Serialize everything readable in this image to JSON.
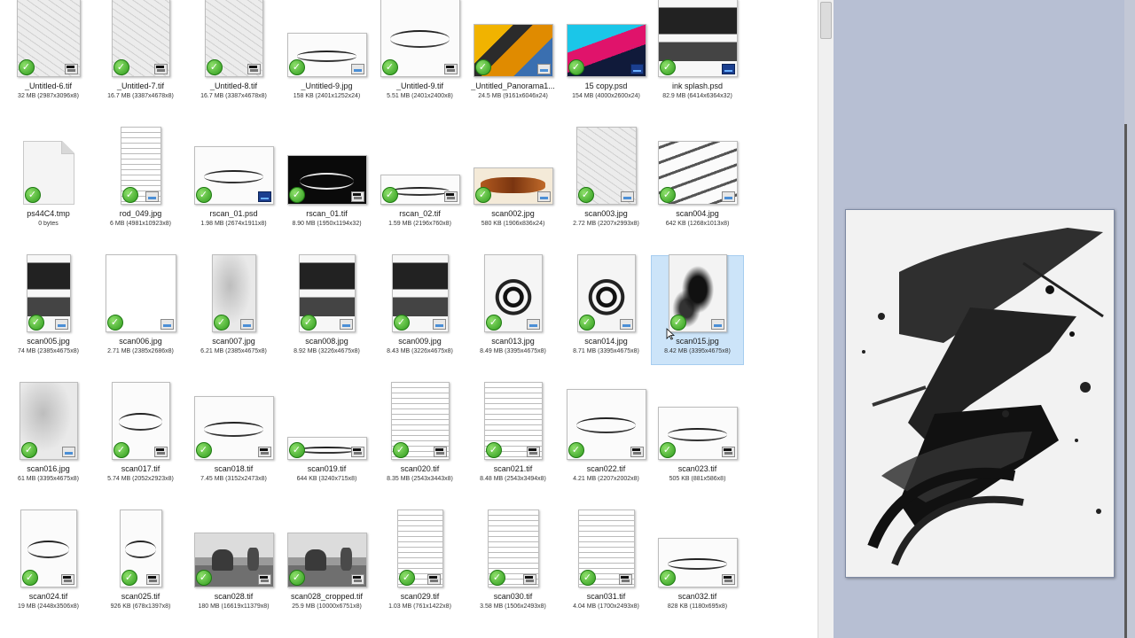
{
  "files": [
    {
      "name": "_Untitled-6.tif",
      "meta": "32 MB (2987x3096x8)",
      "style": "sketch",
      "badge": "tif"
    },
    {
      "name": "_Untitled-7.tif",
      "meta": "16.7 MB (3387x4678x8)",
      "style": "sketch",
      "badge": "tif"
    },
    {
      "name": "_Untitled-8.tif",
      "meta": "16.7 MB (3387x4678x8)",
      "style": "sketch",
      "badge": "tif"
    },
    {
      "name": "_Untitled-9.jpg",
      "meta": "158 KB (2401x1252x24)",
      "style": "script",
      "badge": "jpg"
    },
    {
      "name": "_Untitled-9.tif",
      "meta": "5.51 MB (2401x2400x8)",
      "style": "script",
      "badge": "tif"
    },
    {
      "name": "_Untitled_Panorama1...",
      "meta": "24.5 MB (9161x6046x24)",
      "style": "orange",
      "badge": "jpg"
    },
    {
      "name": "15 copy.psd",
      "meta": "154 MB (4000x2600x24)",
      "style": "neon",
      "badge": "psd"
    },
    {
      "name": "ink splash.psd",
      "meta": "82.9 MB (6414x6364x32)",
      "style": "ink-b",
      "badge": "psd"
    },
    {
      "name": "ps44C4.tmp",
      "meta": "0 bytes",
      "style": "tmp",
      "badge": ""
    },
    {
      "name": "rod_049.jpg",
      "meta": "6 MB (4981x10923x8)",
      "style": "text-doc",
      "badge": "jpg"
    },
    {
      "name": "rscan_01.psd",
      "meta": "1.98 MB (2674x1911x8)",
      "style": "script",
      "badge": "psd"
    },
    {
      "name": "rscan_01.tif",
      "meta": "8.90 MB (1950x1194x32)",
      "style": "black",
      "badge": "tif"
    },
    {
      "name": "rscan_02.tif",
      "meta": "1.59 MB (2196x760x8)",
      "style": "script",
      "badge": "tif"
    },
    {
      "name": "scan002.jpg",
      "meta": "580 KB (1906x836x24)",
      "style": "brown",
      "badge": "jpg"
    },
    {
      "name": "scan003.jpg",
      "meta": "2.72 MB (2207x2993x8)",
      "style": "sketch",
      "badge": "jpg"
    },
    {
      "name": "scan004.jpg",
      "meta": "642 KB (1268x1013x8)",
      "style": "strokes",
      "badge": "jpg"
    },
    {
      "name": "scan005.jpg",
      "meta": "74 MB (2385x4675x8)",
      "style": "ink-b",
      "badge": "jpg"
    },
    {
      "name": "scan006.jpg",
      "meta": "2.71 MB (2385x2686x8)",
      "style": "blank",
      "badge": "jpg"
    },
    {
      "name": "scan007.jpg",
      "meta": "6.21 MB (2385x4675x8)",
      "style": "gray-wash",
      "badge": "jpg"
    },
    {
      "name": "scan008.jpg",
      "meta": "8.92 MB (3226x4675x8)",
      "style": "ink-b",
      "badge": "jpg"
    },
    {
      "name": "scan009.jpg",
      "meta": "8.43 MB (3226x4675x8)",
      "style": "ink-b",
      "badge": "jpg"
    },
    {
      "name": "scan013.jpg",
      "meta": "8.49 MB (3395x4675x8)",
      "style": "ink-c",
      "badge": "jpg"
    },
    {
      "name": "scan014.jpg",
      "meta": "8.71 MB (3395x4675x8)",
      "style": "ink-c",
      "badge": "jpg"
    },
    {
      "name": "scan015.jpg",
      "meta": "8.42 MB (3395x4675x8)",
      "style": "ink-a",
      "badge": "jpg",
      "selected": true
    },
    {
      "name": "scan016.jpg",
      "meta": "61 MB (3395x4675x8)",
      "style": "gray-wash",
      "badge": "jpg"
    },
    {
      "name": "scan017.tif",
      "meta": "5.74 MB (2052x2923x8)",
      "style": "script",
      "badge": "tif"
    },
    {
      "name": "scan018.tif",
      "meta": "7.45 MB (3152x2473x8)",
      "style": "script",
      "badge": "tif"
    },
    {
      "name": "scan019.tif",
      "meta": "644 KB (3240x715x8)",
      "style": "script",
      "badge": "tif"
    },
    {
      "name": "scan020.tif",
      "meta": "8.35 MB (2543x3443x8)",
      "style": "text-doc",
      "badge": "tif"
    },
    {
      "name": "scan021.tif",
      "meta": "8.48 MB (2543x3494x8)",
      "style": "text-doc",
      "badge": "tif"
    },
    {
      "name": "scan022.tif",
      "meta": "4.21 MB (2207x2002x8)",
      "style": "script",
      "badge": "tif"
    },
    {
      "name": "scan023.tif",
      "meta": "505 KB (881x586x8)",
      "style": "script",
      "badge": "tif"
    },
    {
      "name": "scan024.tif",
      "meta": "19 MB (2448x3506x8)",
      "style": "script",
      "badge": "tif"
    },
    {
      "name": "scan025.tif",
      "meta": "926 KB (678x1397x8)",
      "style": "script",
      "badge": "tif"
    },
    {
      "name": "scan028.tif",
      "meta": "180 MB (16619x11379x8)",
      "style": "photo",
      "badge": "tif"
    },
    {
      "name": "scan028_cropped.tif",
      "meta": "25.9 MB (10000x6751x8)",
      "style": "photo",
      "badge": "tif"
    },
    {
      "name": "scan029.tif",
      "meta": "1.03 MB (761x1422x8)",
      "style": "text-doc",
      "badge": "tif"
    },
    {
      "name": "scan030.tif",
      "meta": "3.58 MB (1506x2493x8)",
      "style": "text-doc",
      "badge": "tif"
    },
    {
      "name": "scan031.tif",
      "meta": "4.04 MB (1700x2493x8)",
      "style": "text-doc",
      "badge": "tif"
    },
    {
      "name": "scan032.tif",
      "meta": "828 KB (1180x695x8)",
      "style": "script",
      "badge": "tif"
    }
  ]
}
